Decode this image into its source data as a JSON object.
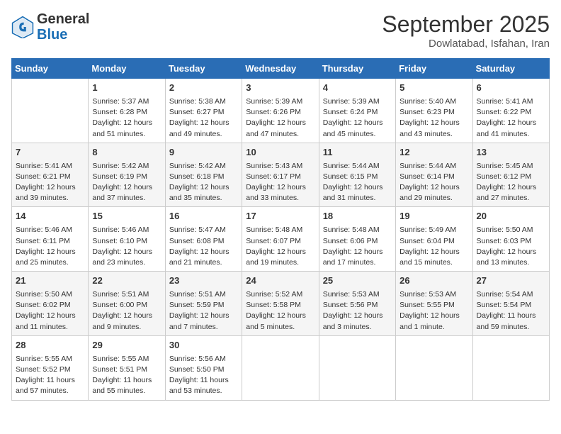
{
  "header": {
    "logo_general": "General",
    "logo_blue": "Blue",
    "month_title": "September 2025",
    "subtitle": "Dowlatabad, Isfahan, Iran"
  },
  "columns": [
    "Sunday",
    "Monday",
    "Tuesday",
    "Wednesday",
    "Thursday",
    "Friday",
    "Saturday"
  ],
  "weeks": [
    [
      {
        "day": "",
        "info": ""
      },
      {
        "day": "1",
        "info": "Sunrise: 5:37 AM\nSunset: 6:28 PM\nDaylight: 12 hours\nand 51 minutes."
      },
      {
        "day": "2",
        "info": "Sunrise: 5:38 AM\nSunset: 6:27 PM\nDaylight: 12 hours\nand 49 minutes."
      },
      {
        "day": "3",
        "info": "Sunrise: 5:39 AM\nSunset: 6:26 PM\nDaylight: 12 hours\nand 47 minutes."
      },
      {
        "day": "4",
        "info": "Sunrise: 5:39 AM\nSunset: 6:24 PM\nDaylight: 12 hours\nand 45 minutes."
      },
      {
        "day": "5",
        "info": "Sunrise: 5:40 AM\nSunset: 6:23 PM\nDaylight: 12 hours\nand 43 minutes."
      },
      {
        "day": "6",
        "info": "Sunrise: 5:41 AM\nSunset: 6:22 PM\nDaylight: 12 hours\nand 41 minutes."
      }
    ],
    [
      {
        "day": "7",
        "info": "Sunrise: 5:41 AM\nSunset: 6:21 PM\nDaylight: 12 hours\nand 39 minutes."
      },
      {
        "day": "8",
        "info": "Sunrise: 5:42 AM\nSunset: 6:19 PM\nDaylight: 12 hours\nand 37 minutes."
      },
      {
        "day": "9",
        "info": "Sunrise: 5:42 AM\nSunset: 6:18 PM\nDaylight: 12 hours\nand 35 minutes."
      },
      {
        "day": "10",
        "info": "Sunrise: 5:43 AM\nSunset: 6:17 PM\nDaylight: 12 hours\nand 33 minutes."
      },
      {
        "day": "11",
        "info": "Sunrise: 5:44 AM\nSunset: 6:15 PM\nDaylight: 12 hours\nand 31 minutes."
      },
      {
        "day": "12",
        "info": "Sunrise: 5:44 AM\nSunset: 6:14 PM\nDaylight: 12 hours\nand 29 minutes."
      },
      {
        "day": "13",
        "info": "Sunrise: 5:45 AM\nSunset: 6:12 PM\nDaylight: 12 hours\nand 27 minutes."
      }
    ],
    [
      {
        "day": "14",
        "info": "Sunrise: 5:46 AM\nSunset: 6:11 PM\nDaylight: 12 hours\nand 25 minutes."
      },
      {
        "day": "15",
        "info": "Sunrise: 5:46 AM\nSunset: 6:10 PM\nDaylight: 12 hours\nand 23 minutes."
      },
      {
        "day": "16",
        "info": "Sunrise: 5:47 AM\nSunset: 6:08 PM\nDaylight: 12 hours\nand 21 minutes."
      },
      {
        "day": "17",
        "info": "Sunrise: 5:48 AM\nSunset: 6:07 PM\nDaylight: 12 hours\nand 19 minutes."
      },
      {
        "day": "18",
        "info": "Sunrise: 5:48 AM\nSunset: 6:06 PM\nDaylight: 12 hours\nand 17 minutes."
      },
      {
        "day": "19",
        "info": "Sunrise: 5:49 AM\nSunset: 6:04 PM\nDaylight: 12 hours\nand 15 minutes."
      },
      {
        "day": "20",
        "info": "Sunrise: 5:50 AM\nSunset: 6:03 PM\nDaylight: 12 hours\nand 13 minutes."
      }
    ],
    [
      {
        "day": "21",
        "info": "Sunrise: 5:50 AM\nSunset: 6:02 PM\nDaylight: 12 hours\nand 11 minutes."
      },
      {
        "day": "22",
        "info": "Sunrise: 5:51 AM\nSunset: 6:00 PM\nDaylight: 12 hours\nand 9 minutes."
      },
      {
        "day": "23",
        "info": "Sunrise: 5:51 AM\nSunset: 5:59 PM\nDaylight: 12 hours\nand 7 minutes."
      },
      {
        "day": "24",
        "info": "Sunrise: 5:52 AM\nSunset: 5:58 PM\nDaylight: 12 hours\nand 5 minutes."
      },
      {
        "day": "25",
        "info": "Sunrise: 5:53 AM\nSunset: 5:56 PM\nDaylight: 12 hours\nand 3 minutes."
      },
      {
        "day": "26",
        "info": "Sunrise: 5:53 AM\nSunset: 5:55 PM\nDaylight: 12 hours\nand 1 minute."
      },
      {
        "day": "27",
        "info": "Sunrise: 5:54 AM\nSunset: 5:54 PM\nDaylight: 11 hours\nand 59 minutes."
      }
    ],
    [
      {
        "day": "28",
        "info": "Sunrise: 5:55 AM\nSunset: 5:52 PM\nDaylight: 11 hours\nand 57 minutes."
      },
      {
        "day": "29",
        "info": "Sunrise: 5:55 AM\nSunset: 5:51 PM\nDaylight: 11 hours\nand 55 minutes."
      },
      {
        "day": "30",
        "info": "Sunrise: 5:56 AM\nSunset: 5:50 PM\nDaylight: 11 hours\nand 53 minutes."
      },
      {
        "day": "",
        "info": ""
      },
      {
        "day": "",
        "info": ""
      },
      {
        "day": "",
        "info": ""
      },
      {
        "day": "",
        "info": ""
      }
    ]
  ]
}
